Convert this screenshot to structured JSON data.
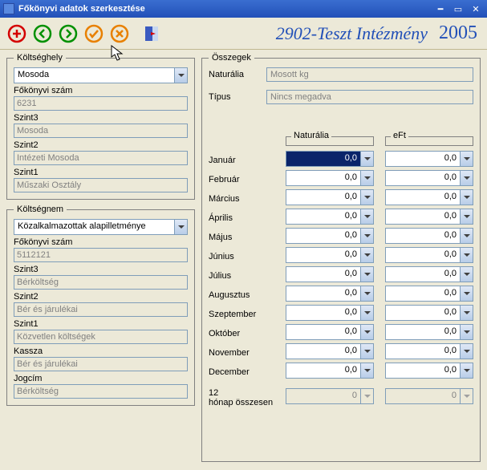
{
  "window": {
    "title": "Főkönyvi adatok szerkesztése"
  },
  "header": {
    "institution": "2902-Teszt Intézmény",
    "year": "2005"
  },
  "koltseghely": {
    "legend": "Költséghely",
    "combo": "Mosoda",
    "fokonyvi_label": "Főkönyvi szám",
    "fokonyvi": "6231",
    "szint3_label": "Szint3",
    "szint3": "Mosoda",
    "szint2_label": "Szint2",
    "szint2": "Intézeti Mosoda",
    "szint1_label": "Szint1",
    "szint1": "Műszaki Osztály"
  },
  "koltsegnem": {
    "legend": "Költségnem",
    "combo": "Közalkalmazottak alapilletménye",
    "fokonyvi_label": "Főkönyvi szám",
    "fokonyvi": "5112121",
    "szint3_label": "Szint3",
    "szint3": "Bérköltség",
    "szint2_label": "Szint2",
    "szint2": "Bér és járulékai",
    "szint1_label": "Szint1",
    "szint1": "Közvetlen költségek",
    "kassza_label": "Kassza",
    "kassza": "Bér és járulékai",
    "jogcim_label": "Jogcím",
    "jogcim": "Bérköltség"
  },
  "osszegek": {
    "legend": "Összegek",
    "naturalia_label": "Naturália",
    "naturalia": "Mosott kg",
    "tipus_label": "Típus",
    "tipus": "Nincs megadva",
    "colnat": "Naturália",
    "coleft": "eFt",
    "months": [
      "Január",
      "Február",
      "Március",
      "Április",
      "Május",
      "Június",
      "Július",
      "Augusztus",
      "Szeptember",
      "Október",
      "November",
      "December"
    ],
    "nat": [
      "0,0",
      "0,0",
      "0,0",
      "0,0",
      "0,0",
      "0,0",
      "0,0",
      "0,0",
      "0,0",
      "0,0",
      "0,0",
      "0,0"
    ],
    "eft": [
      "0,0",
      "0,0",
      "0,0",
      "0,0",
      "0,0",
      "0,0",
      "0,0",
      "0,0",
      "0,0",
      "0,0",
      "0,0",
      "0,0"
    ],
    "total_label": "12 hónap összesen",
    "total_nat": "0",
    "total_eft": "0"
  }
}
